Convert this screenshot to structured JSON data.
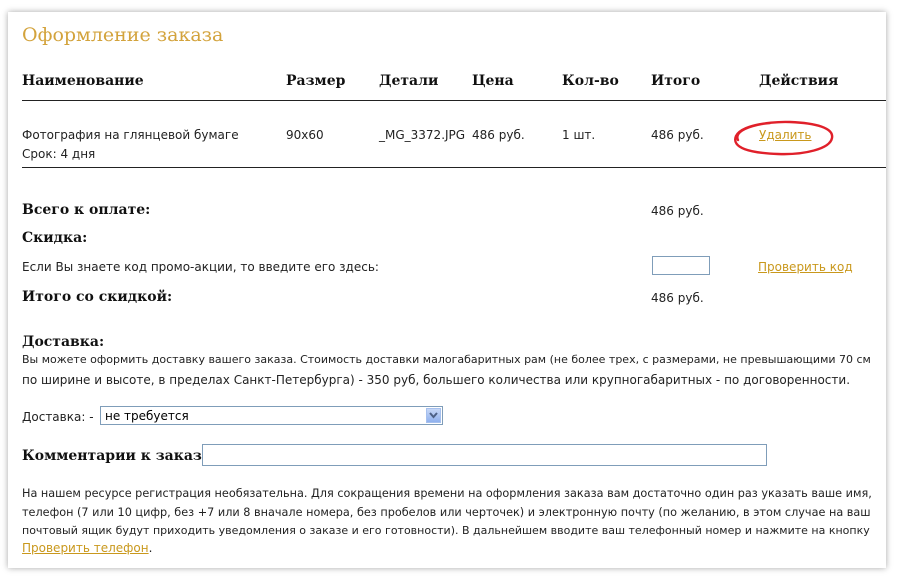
{
  "page_title": "Оформление заказа",
  "table": {
    "headers": [
      "Наименование",
      "Размер",
      "Детали",
      "Цена",
      "Кол-во",
      "Итого",
      "Действия"
    ],
    "row": {
      "name": "Фотография  на глянцевой бумаге",
      "term": "Срок: 4 дня",
      "size": "90x60",
      "details": "_MG_3372.JPG",
      "price": "486 руб.",
      "qty": "1 шт.",
      "total": "486 руб.",
      "action": "Удалить"
    }
  },
  "summary": {
    "total_label": "Всего к оплате:",
    "total_value": "486 руб.",
    "discount_label": "Скидка:",
    "promo_prompt": "Если Вы знаете код промо-акции, то введите его здесь:",
    "promo_value": "",
    "check_code": "Проверить код",
    "discounted_label": "Итого со скидкой:",
    "discounted_value": "486 руб."
  },
  "delivery": {
    "heading": "Доставка:",
    "text_line1": "Вы можете оформить доставку вашего заказа. Стоимость доставки малогабаритных рам (не более трех, с размерами, не превышающими 70 см",
    "text_line2": "по ширине и высоте, в пределах Санкт-Петербурга) - 350 руб, большего количества или крупногабаритных - по договоренности.",
    "select_label": "Доставка:  -",
    "select_value": "не требуется"
  },
  "comments": {
    "label": "Комментарии к заказу:",
    "value": ""
  },
  "registration": {
    "line1": "На нашем ресурсе регистрация необязательна. Для сокращения времени на оформления заказа вам достаточно один раз указать ваше имя,",
    "line2": "телефон (7 или 10 цифр, без +7 или 8 вначале номера, без пробелов или черточек) и электронную почту (по желанию, в этом случае на ваш",
    "line3": "почтовый ящик будут приходить уведомления о заказе и его готовности). В дальнейшем вводите ваш телефонный номер и нажмите на кнопку",
    "link": "Проверить телефон",
    "suffix": "."
  },
  "colors": {
    "title": "#d3a33c",
    "link": "#c9981c",
    "annotation": "#e0202a"
  }
}
